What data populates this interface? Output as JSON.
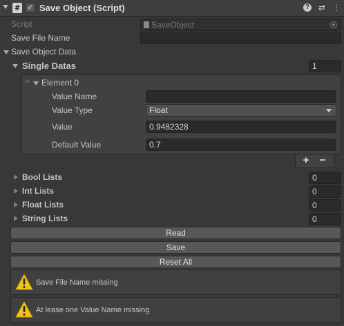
{
  "header": {
    "title": "Save Object (Script)",
    "script_glyph": "#",
    "enabled_glyph": "✓",
    "help_glyph": "?",
    "presets_glyph": "⇄",
    "menu_glyph": "⋮"
  },
  "fields": {
    "script_label": "Script",
    "script_value": "SaveObject",
    "save_file_name_label": "Save File Name",
    "save_file_name_value": ""
  },
  "save_object_data": {
    "label": "Save Object Data",
    "single_datas": {
      "label": "Single Datas",
      "size": "1",
      "element": {
        "label": "Element 0",
        "value_name_label": "Value Name",
        "value_name_value": "",
        "value_type_label": "Value Type",
        "value_type_selected": "Float",
        "value_label": "Value",
        "value_value": "0.9482328",
        "default_value_label": "Default Value",
        "default_value_value": "0.7"
      },
      "add_glyph": "+",
      "remove_glyph": "−"
    },
    "lists": [
      {
        "label": "Bool Lists",
        "size": "0"
      },
      {
        "label": "Int Lists",
        "size": "0"
      },
      {
        "label": "Float Lists",
        "size": "0"
      },
      {
        "label": "String Lists",
        "size": "0"
      }
    ]
  },
  "buttons": {
    "read": "Read",
    "save": "Save",
    "reset_all": "Reset All"
  },
  "warnings": [
    {
      "text": "Save File Name missing"
    },
    {
      "text": "At lease one Value Name missing"
    }
  ],
  "colors": {
    "background": "#383838",
    "field": "#2a2a2a",
    "button": "#585858",
    "warning_icon": "#f0c419"
  },
  "icons": {
    "script": "script-hash-icon",
    "warning": "warning-triangle-icon",
    "help": "help-icon",
    "presets": "presets-icon",
    "menu": "kebab-menu-icon"
  }
}
